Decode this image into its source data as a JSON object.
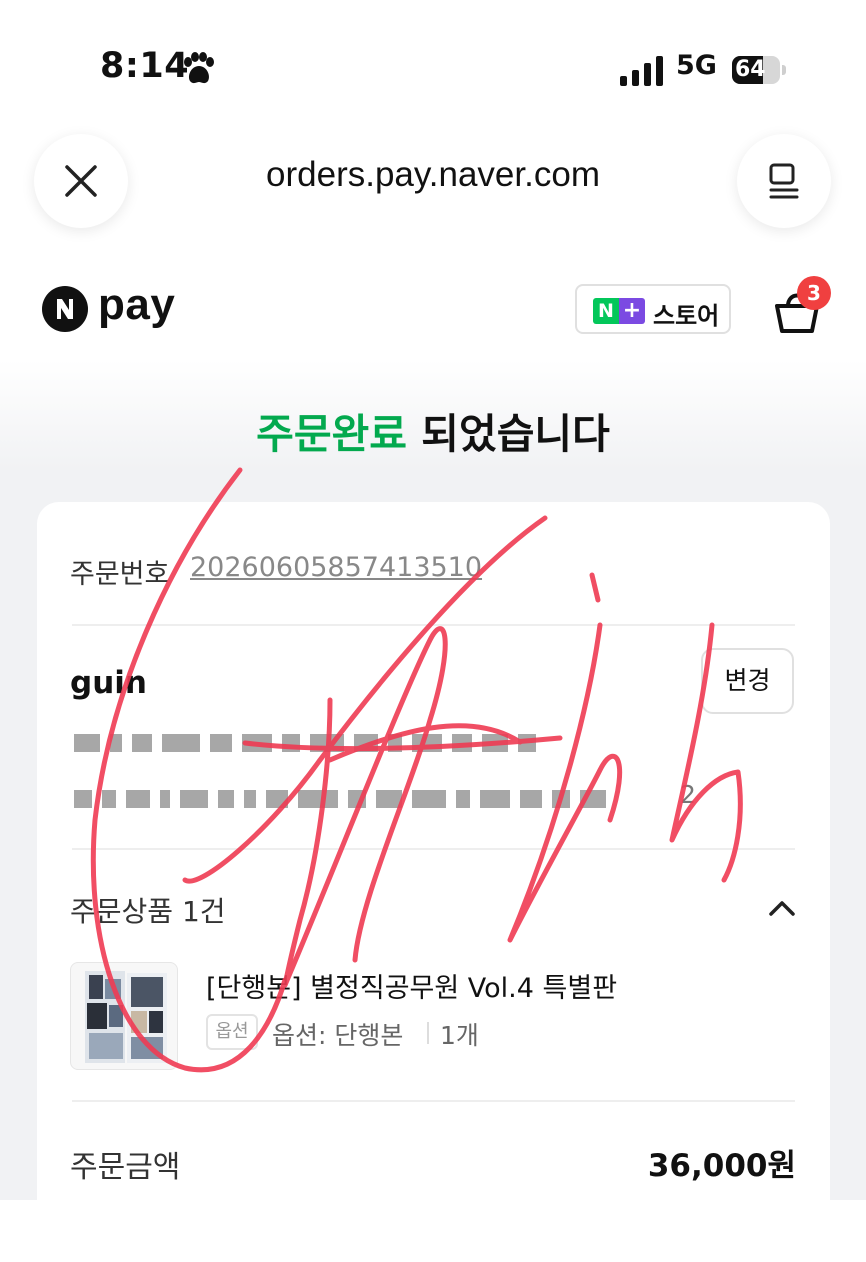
{
  "status_bar": {
    "time": "8:14",
    "network": "5G",
    "battery": "64",
    "battery_level": 0.64
  },
  "browser": {
    "url": "orders.pay.naver.com"
  },
  "header": {
    "brand": "pay",
    "store_label": "스토어",
    "store_n": "N",
    "store_plus": "+",
    "cart_count": "3"
  },
  "title": {
    "highlight": "주문완료",
    "rest": " 되었습니다"
  },
  "order": {
    "label": "주문번호",
    "number": "20260605857413510"
  },
  "shipping": {
    "recipient": "guin",
    "change_label": "변경",
    "address_suffix": "2"
  },
  "products": {
    "section_label": "주문상품 1건",
    "items": [
      {
        "name": "[단행본] 별정직공무원 Vol.4 특별판",
        "option_tag": "옵션",
        "option": "옵션: 단행본",
        "quantity": "1개"
      }
    ]
  },
  "summary": {
    "total_label": "주문금액",
    "total_value": "36,000원"
  },
  "colors": {
    "accent_green": "#03a94e",
    "naver_green": "#03c75a",
    "plus_purple": "#7b4ae2",
    "badge_red": "#f04040",
    "signature_red": "#ef3b53"
  },
  "icons": [
    "paw-icon",
    "signal-icon",
    "battery-icon",
    "close-icon",
    "menu-icon",
    "npay-logo-icon",
    "cart-icon",
    "chevron-up-icon"
  ]
}
